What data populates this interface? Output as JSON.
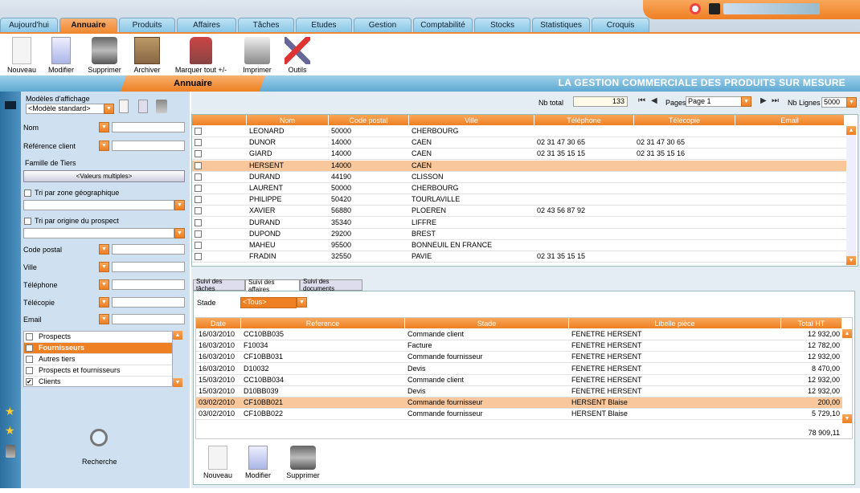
{
  "tabs": [
    "Aujourd'hui",
    "Annuaire",
    "Produits",
    "Affaires",
    "Tâches",
    "Etudes",
    "Gestion",
    "Comptabilité",
    "Stocks",
    "Statistiques",
    "Croquis"
  ],
  "toolbar": {
    "nouveau": "Nouveau",
    "modifier": "Modifier",
    "supprimer": "Supprimer",
    "archiver": "Archiver",
    "marquer": "Marquer tout +/-",
    "imprimer": "Imprimer",
    "outils": "Outils"
  },
  "section_title": "Annuaire",
  "slogan": "LA GESTION COMMERCIALE DES PRODUITS SUR MESURE",
  "left": {
    "modeles_label": "Modèles d'affichage",
    "modele_value": "<Modèle standard>",
    "nom": "Nom",
    "ref": "Référence client",
    "famille": "Famille de Tiers",
    "valeurs": "<Valeurs multiples>",
    "tri_zone": "Tri par zone géographique",
    "tri_origine": "Tri par origine du prospect",
    "cp": "Code postal",
    "ville": "Ville",
    "tel": "Téléphone",
    "fax": "Télécopie",
    "email": "Email",
    "types": [
      "Prospects",
      "Fournisseurs",
      "Autres tiers",
      "Prospects et fournisseurs",
      "Clients"
    ],
    "recherche": "Recherche"
  },
  "pager": {
    "nb_total_label": "Nb total",
    "nb_total": "133",
    "pages_label": "Pages",
    "page": "Page 1",
    "nb_lignes_label": "Nb Lignes",
    "nb_lignes": "5000"
  },
  "grid": {
    "headers": [
      "Nom",
      "Code postal",
      "Ville",
      "Téléphone",
      "Télécopie",
      "Email"
    ],
    "rows": [
      [
        "LEONARD",
        "50000",
        "CHERBOURG",
        "",
        "",
        ""
      ],
      [
        "DUNOR",
        "14000",
        "CAEN",
        "02 31 47 30 65",
        "02 31 47 30 65",
        ""
      ],
      [
        "GIARD",
        "14000",
        "CAEN",
        "02 31 35 15 15",
        "02 31 35 15 16",
        ""
      ],
      [
        "HERSENT",
        "14000",
        "CAEN",
        "",
        "",
        ""
      ],
      [
        "DURAND",
        "44190",
        "CLISSON",
        "",
        "",
        ""
      ],
      [
        "LAURENT",
        "50000",
        "CHERBOURG",
        "",
        "",
        ""
      ],
      [
        "PHILIPPE",
        "50420",
        "TOURLAVILLE",
        "",
        "",
        ""
      ],
      [
        "XAVIER",
        "56880",
        "PLOEREN",
        "02 43 56 87 92",
        "",
        ""
      ],
      [
        "DURAND",
        "35340",
        "LIFFRE",
        "",
        "",
        ""
      ],
      [
        "DUPOND",
        "29200",
        "BREST",
        "",
        "",
        ""
      ],
      [
        "MAHEU",
        "95500",
        "BONNEUIL EN FRANCE",
        "",
        "",
        ""
      ],
      [
        "FRADIN",
        "32550",
        "PAVIE",
        "02 31 35 15 15",
        "",
        ""
      ]
    ]
  },
  "bottom": {
    "tabs": [
      "Suivi des tâches",
      "Suivi des affaires",
      "Suivi des documents"
    ],
    "stade_label": "Stade",
    "stade_value": "<Tous>",
    "headers": [
      "Date",
      "Reference",
      "Stade",
      "Libelle pièce",
      "Total HT"
    ],
    "rows": [
      [
        "16/03/2010",
        "CC10BB035",
        "Commande client",
        "FENETRE HERSENT",
        "12 932,00"
      ],
      [
        "16/03/2010",
        "F10034",
        "Facture",
        "FENETRE HERSENT",
        "12 782,00"
      ],
      [
        "16/03/2010",
        "CF10BB031",
        "Commande fournisseur",
        "FENETRE HERSENT",
        "12 932,00"
      ],
      [
        "16/03/2010",
        "D10032",
        "Devis",
        "FENETRE HERSENT",
        "8 470,00"
      ],
      [
        "15/03/2010",
        "CC10BB034",
        "Commande client",
        "FENETRE HERSENT",
        "12 932,00"
      ],
      [
        "15/03/2010",
        "D10BB039",
        "Devis",
        "FENETRE HERSENT",
        "12 932,00"
      ],
      [
        "03/02/2010",
        "CF10BB021",
        "Commande fournisseur",
        "HERSENT Blaise",
        "200,00"
      ],
      [
        "03/02/2010",
        "CF10BB022",
        "Commande fournisseur",
        "HERSENT Blaise",
        "5 729,10"
      ]
    ],
    "total": "78 909,11",
    "actions": [
      "Nouveau",
      "Modifier",
      "Supprimer"
    ]
  }
}
